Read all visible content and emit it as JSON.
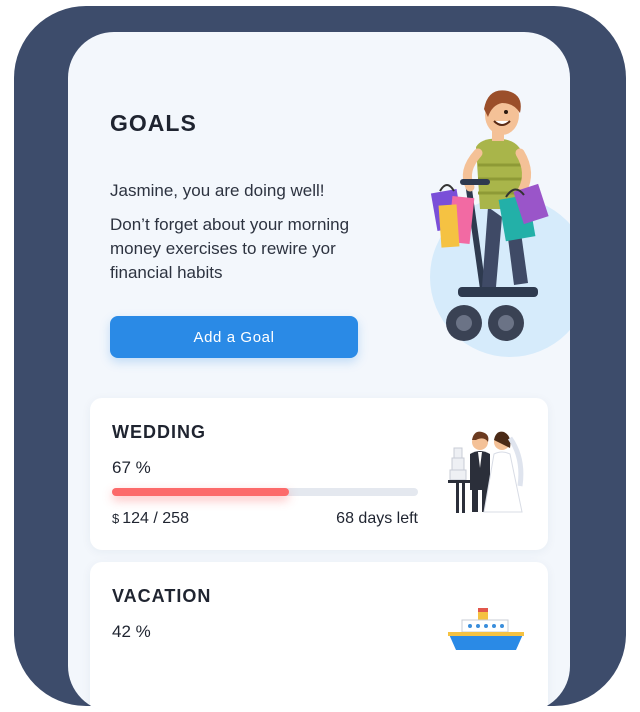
{
  "header": {
    "title": "GOALS"
  },
  "intro": {
    "greeting": "Jasmine, you are doing well!",
    "reminder": "Don’t forget about your morning money exercises to rewire yor financial habits"
  },
  "actions": {
    "add_goal_label": "Add a Goal"
  },
  "colors": {
    "accent": "#2a8ae6",
    "progress": "#fc6a6a",
    "frame": "#3d4c6b"
  },
  "goals": [
    {
      "title": "WEDDING",
      "percent_label": "67 %",
      "progress": 0.58,
      "currency": "$",
      "amount": "124 / 258",
      "days_left": "68 days left",
      "icon": "wedding-couple-icon"
    },
    {
      "title": "VACATION",
      "percent_label": "42 %",
      "icon": "cruise-ship-icon"
    }
  ]
}
